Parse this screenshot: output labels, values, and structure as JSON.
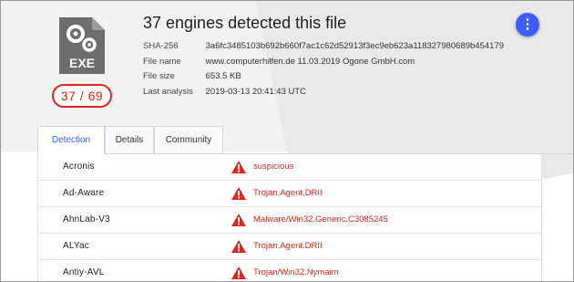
{
  "header": {
    "file_type": "EXE",
    "detection_ratio": "37 / 69",
    "title": "37 engines detected this file",
    "more_button": "⋮"
  },
  "meta": [
    {
      "label": "SHA-256",
      "value": "3a6fc3485103b692b660f7ac1c62d52913f3ec9eb623a118327980689b454179"
    },
    {
      "label": "File name",
      "value": "www.computerhilfen.de 11.03.2019 Ogone GmbH.com"
    },
    {
      "label": "File size",
      "value": "653.5 KB"
    },
    {
      "label": "Last analysis",
      "value": "2019-03-13 20:41:43 UTC"
    }
  ],
  "tabs": [
    {
      "label": "Detection",
      "active": true
    },
    {
      "label": "Details",
      "active": false
    },
    {
      "label": "Community",
      "active": false
    }
  ],
  "detections": [
    {
      "engine": "Acronis",
      "result": "suspicious"
    },
    {
      "engine": "Ad-Aware",
      "result": "Trojan.Agent.DRII"
    },
    {
      "engine": "AhnLab-V3",
      "result": "Malware/Win32.Generic.C3085245"
    },
    {
      "engine": "ALYac",
      "result": "Trojan.Agent.DRII"
    },
    {
      "engine": "Antiy-AVL",
      "result": "Trojan/Win32.Nymaim"
    }
  ],
  "colors": {
    "accent": "#3e5eff",
    "danger": "#e0271f",
    "icon_gray": "#707070"
  },
  "icons": {
    "file": "exe-file-icon",
    "warning": "warning-triangle-icon",
    "more": "vertical-dots-icon"
  }
}
